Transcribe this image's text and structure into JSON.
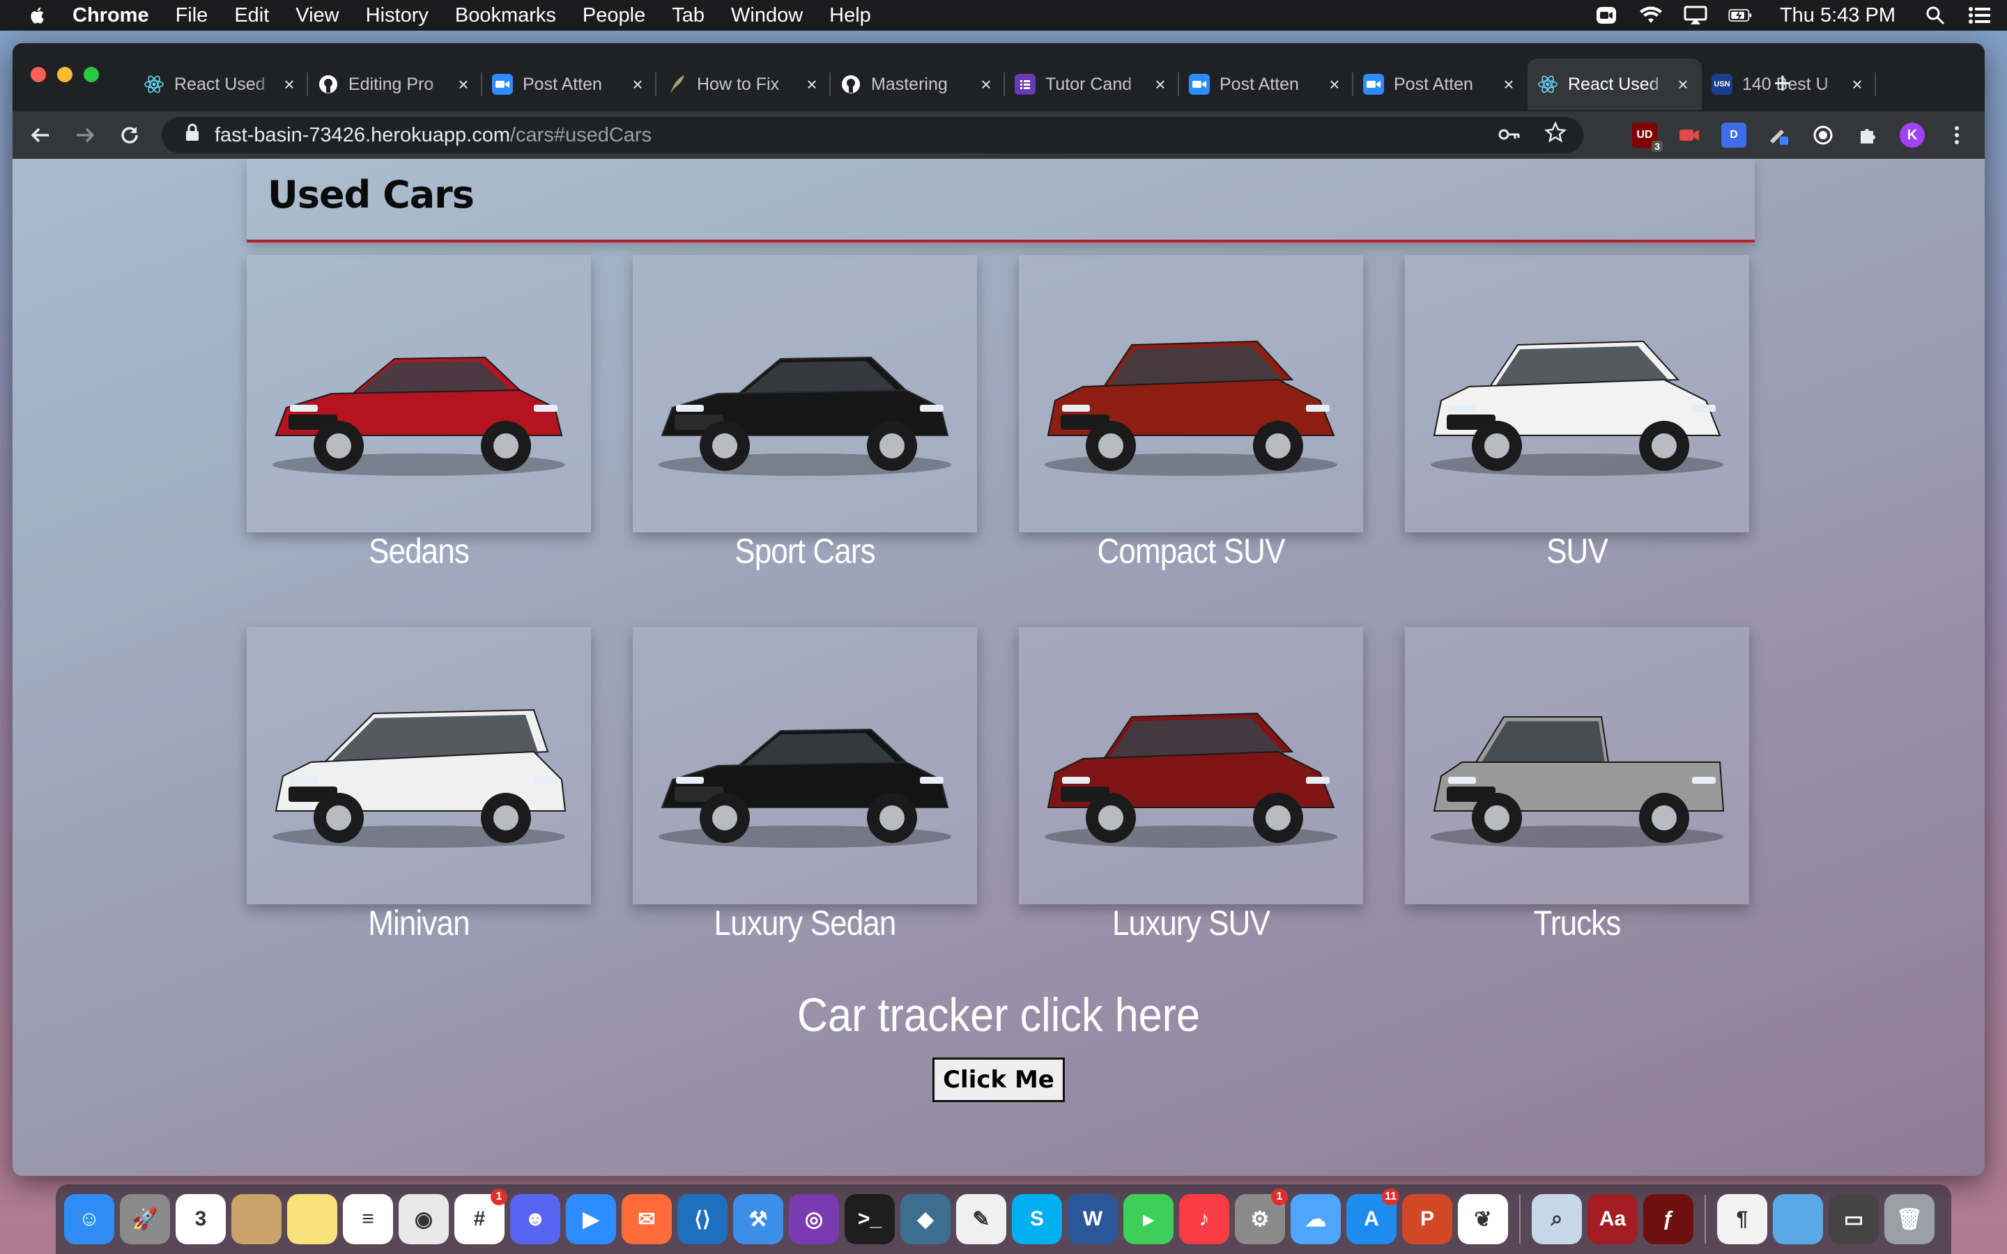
{
  "menubar": {
    "apple_icon": "apple-logo-icon",
    "app_name": "Chrome",
    "items": [
      "File",
      "Edit",
      "View",
      "History",
      "Bookmarks",
      "People",
      "Tab",
      "Window",
      "Help"
    ],
    "clock": "Thu 5:43 PM",
    "status_icons": [
      "zoom-icon",
      "wifi-icon",
      "airplay-icon",
      "battery-icon",
      "search-icon",
      "control-center-icon"
    ]
  },
  "browser": {
    "tabs": [
      {
        "title": "React Used",
        "icon": "react-icon",
        "color": "#61dafb"
      },
      {
        "title": "Editing Pro",
        "icon": "github-icon",
        "color": "#ffffff"
      },
      {
        "title": "Post Atten",
        "icon": "zoom-icon",
        "color": "#2d8cff"
      },
      {
        "title": "How to Fix",
        "icon": "quill-icon",
        "color": "#a3a36b"
      },
      {
        "title": "Mastering",
        "icon": "github-icon",
        "color": "#ffffff"
      },
      {
        "title": "Tutor Cand",
        "icon": "forms-icon",
        "color": "#673ab7"
      },
      {
        "title": "Post Atten",
        "icon": "zoom-icon",
        "color": "#2d8cff"
      },
      {
        "title": "Post Atten",
        "icon": "zoom-icon",
        "color": "#2d8cff"
      },
      {
        "title": "React Used",
        "icon": "react-icon",
        "color": "#61dafb",
        "active": true
      },
      {
        "title": "140 Best U",
        "icon": "usn-icon",
        "color": "#1a3d8f"
      }
    ],
    "url_host": "fast-basin-73426.herokuapp.com",
    "url_path": "/cars#usedCars",
    "extensions": [
      {
        "name": "ublock-icon",
        "label": "UD",
        "badge": "3",
        "color": "#800000"
      },
      {
        "name": "video-extension-icon",
        "label": "",
        "color": "#e04a4a"
      },
      {
        "name": "d-extension-icon",
        "label": "D",
        "color": "#3b6ee8"
      },
      {
        "name": "eyedropper-icon",
        "label": "",
        "color": "#3a82f7"
      },
      {
        "name": "circle-extension-icon",
        "label": "",
        "color": "#ffffff"
      },
      {
        "name": "puzzle-icon",
        "label": "",
        "color": "#e8eaed"
      },
      {
        "name": "profile-avatar",
        "label": "K",
        "color": "#a142f4"
      },
      {
        "name": "kebab-menu-icon",
        "label": "",
        "color": "#e8eaed"
      }
    ]
  },
  "page": {
    "title": "Used Cars",
    "cars": [
      {
        "label": "Sedans",
        "color": "#b3141f",
        "icon": "sedan-car-icon"
      },
      {
        "label": "Sport Cars",
        "color": "#161616",
        "icon": "sport-car-icon"
      },
      {
        "label": "Compact SUV",
        "color": "#8e1d12",
        "icon": "compact-suv-icon"
      },
      {
        "label": "SUV",
        "color": "#f2f2f2",
        "icon": "suv-icon"
      },
      {
        "label": "Minivan",
        "color": "#f0f0f0",
        "icon": "minivan-icon"
      },
      {
        "label": "Luxury Sedan",
        "color": "#141414",
        "icon": "luxury-sedan-icon"
      },
      {
        "label": "Luxury SUV",
        "color": "#7e1414",
        "icon": "luxury-suv-icon"
      },
      {
        "label": "Trucks",
        "color": "#9a9a9a",
        "icon": "truck-icon"
      }
    ],
    "tracker_text": "Car tracker click here",
    "button_label": "Click Me",
    "accent_color": "#b3222c"
  },
  "dock": {
    "apps": [
      {
        "name": "finder-icon",
        "color": "#2f8ef6",
        "glyph": "☺"
      },
      {
        "name": "launchpad-icon",
        "color": "#8a8a8a",
        "glyph": "🚀"
      },
      {
        "name": "calendar-icon",
        "color": "#ffffff",
        "glyph": "3"
      },
      {
        "name": "notes-calendar-icon",
        "color": "#c9a36b",
        "glyph": ""
      },
      {
        "name": "notes-icon",
        "color": "#f7e27a",
        "glyph": ""
      },
      {
        "name": "reminders-icon",
        "color": "#ffffff",
        "glyph": "≡"
      },
      {
        "name": "chrome-icon",
        "color": "#e8e8e8",
        "glyph": "◉"
      },
      {
        "name": "slack-icon",
        "color": "#ffffff",
        "glyph": "#",
        "badge": "1"
      },
      {
        "name": "discord-icon",
        "color": "#5865f2",
        "glyph": "☻"
      },
      {
        "name": "zoom-icon",
        "color": "#2d8cff",
        "glyph": "▶"
      },
      {
        "name": "postman-icon",
        "color": "#ff6c37",
        "glyph": "✉"
      },
      {
        "name": "vscode-icon",
        "color": "#1f6fbf",
        "glyph": "⟨⟩"
      },
      {
        "name": "xcode-icon",
        "color": "#3c8ee6",
        "glyph": "⚒"
      },
      {
        "name": "github-desktop-icon",
        "color": "#7a3bb0",
        "glyph": "◎"
      },
      {
        "name": "terminal-icon",
        "color": "#1e1e1e",
        "glyph": ">_"
      },
      {
        "name": "mysql-workbench-icon",
        "color": "#3e6e8f",
        "glyph": "◆"
      },
      {
        "name": "textedit-icon",
        "color": "#f0f0f0",
        "glyph": "✎"
      },
      {
        "name": "skype-icon",
        "color": "#00aff0",
        "glyph": "S"
      },
      {
        "name": "word-icon",
        "color": "#2b579a",
        "glyph": "W"
      },
      {
        "name": "facetime-icon",
        "color": "#3ecf5a",
        "glyph": "▸"
      },
      {
        "name": "music-icon",
        "color": "#fc3c44",
        "glyph": "♪"
      },
      {
        "name": "system-preferences-icon",
        "color": "#8a8a8a",
        "glyph": "⚙",
        "badge": "1"
      },
      {
        "name": "icloud-icon",
        "color": "#4fa6ff",
        "glyph": "☁"
      },
      {
        "name": "app-store-icon",
        "color": "#1c8cf0",
        "glyph": "A",
        "badge": "11"
      },
      {
        "name": "powerpoint-icon",
        "color": "#d24726",
        "glyph": "P"
      },
      {
        "name": "mongodb-icon",
        "color": "#ffffff",
        "glyph": "❦"
      },
      {
        "divider": true
      },
      {
        "name": "preview-icon",
        "color": "#c8d7e8",
        "glyph": "⌕"
      },
      {
        "name": "dictionary-icon",
        "color": "#a31d22",
        "glyph": "Aa"
      },
      {
        "name": "flash-icon",
        "color": "#6e1010",
        "glyph": "ƒ"
      },
      {
        "divider": true
      },
      {
        "name": "document-icon",
        "color": "#f2f2f2",
        "glyph": "¶"
      },
      {
        "name": "folder-icon",
        "color": "#5aa9e6",
        "glyph": ""
      },
      {
        "name": "screenshot-icon",
        "color": "#444444",
        "glyph": "▭"
      },
      {
        "name": "trash-icon",
        "color": "#9aa0a6",
        "glyph": "🗑"
      }
    ]
  }
}
